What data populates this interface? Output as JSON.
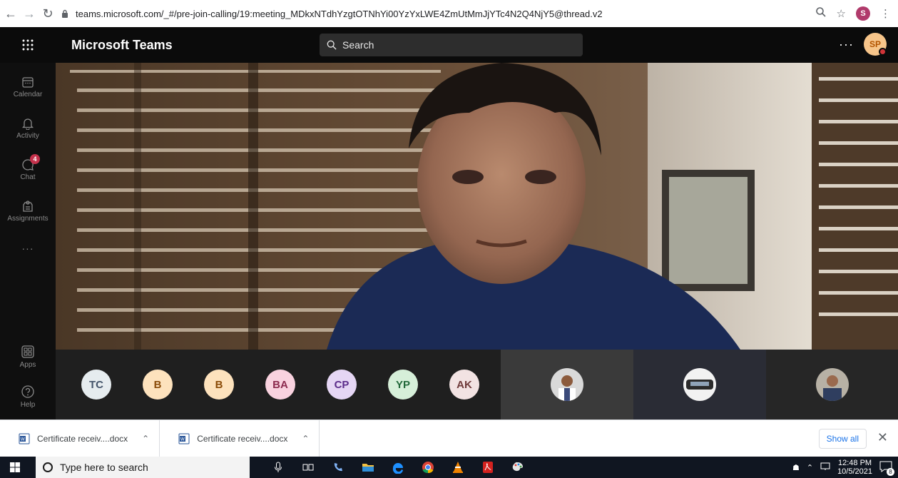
{
  "browser": {
    "url": "teams.microsoft.com/_#/pre-join-calling/19:meeting_MDkxNTdhYzgtOTNhYi00YzYxLWE4ZmUtMmJjYTc4N2Q4NjY5@thread.v2",
    "profile_initial": "S"
  },
  "teams": {
    "app_title": "Microsoft Teams",
    "search_placeholder": "Search",
    "more_label": "···",
    "user_initials": "SP"
  },
  "rail": {
    "items": [
      {
        "label": "Calendar",
        "icon": "calendar-icon"
      },
      {
        "label": "Activity",
        "icon": "bell-icon"
      },
      {
        "label": "Chat",
        "icon": "chat-icon",
        "badge": "4"
      },
      {
        "label": "Assignments",
        "icon": "assignments-icon"
      },
      {
        "label": "···",
        "icon": "more-icon"
      },
      {
        "label": "Apps",
        "icon": "apps-icon"
      },
      {
        "label": "Help",
        "icon": "help-icon"
      }
    ]
  },
  "participants": [
    {
      "initials": "TC",
      "bg": "#e6ecef",
      "fg": "#44546a"
    },
    {
      "initials": "B",
      "bg": "#fde2bd",
      "fg": "#8a4b08"
    },
    {
      "initials": "B",
      "bg": "#fde2bd",
      "fg": "#8a4b08"
    },
    {
      "initials": "BA",
      "bg": "#f9d2df",
      "fg": "#8c2a4e"
    },
    {
      "initials": "CP",
      "bg": "#e5d6f4",
      "fg": "#5b2c8a"
    },
    {
      "initials": "YP",
      "bg": "#d6efd9",
      "fg": "#22683a"
    },
    {
      "initials": "AK",
      "bg": "#f2e3e3",
      "fg": "#6f3b3b"
    }
  ],
  "downloads": {
    "items": [
      {
        "name": "Certificate receiv....docx"
      },
      {
        "name": "Certificate receiv....docx"
      }
    ],
    "show_all": "Show all"
  },
  "taskbar": {
    "search_placeholder": "Type here to search",
    "time": "12:48 PM",
    "date": "10/5/2021",
    "notif_count": "8"
  }
}
